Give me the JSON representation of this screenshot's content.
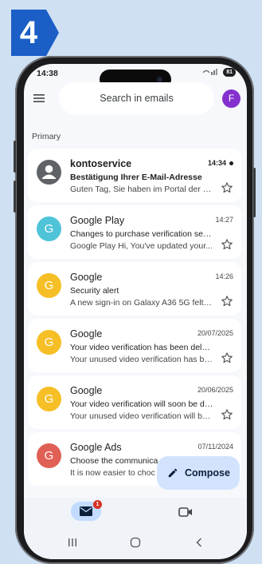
{
  "step": {
    "number": "4",
    "color": "#1a5ec6"
  },
  "status_bar": {
    "time": "14:38",
    "battery": "81"
  },
  "search": {
    "placeholder": "Search in emails"
  },
  "account": {
    "initial": "F",
    "color": "#8430ce"
  },
  "section": {
    "label": "Primary"
  },
  "emails": [
    {
      "sender": "kontoservice",
      "time": "14:34",
      "subject": "Bestätigung Ihrer E-Mail-Adresse",
      "snippet": "Guten Tag, Sie haben im Portal der B...",
      "avatar": "person-icon",
      "avatar_color": "#5f6368",
      "unread": true
    },
    {
      "sender": "Google Play",
      "time": "14:27",
      "subject": "Changes to purchase verification sett...",
      "snippet": "Google Play Hi, You've updated your...",
      "avatar": "G",
      "avatar_color": "#4fc3d8",
      "unread": false
    },
    {
      "sender": "Google",
      "time": "14:26",
      "subject": "Security alert",
      "snippet": "A new sign-in on Galaxy A36 5G felto...",
      "avatar": "G",
      "avatar_color": "#f6bf26",
      "unread": false
    },
    {
      "sender": "Google",
      "time": "20/07/2025",
      "subject": "Your video verification has been delet...",
      "snippet": "Your unused video verification has be...",
      "avatar": "G",
      "avatar_color": "#f6bf26",
      "unread": false
    },
    {
      "sender": "Google",
      "time": "20/06/2025",
      "subject": "Your video verification will soon be de...",
      "snippet": "Your unused video verification will be...",
      "avatar": "G",
      "avatar_color": "#f6bf26",
      "unread": false
    },
    {
      "sender": "Google Ads",
      "time": "07/11/2024",
      "subject": "Choose the communica",
      "snippet": "It is now easier to choc",
      "avatar": "G",
      "avatar_color": "#e06055",
      "unread": false
    }
  ],
  "compose": {
    "label": "Compose"
  },
  "bottom_nav": {
    "mail_badge": "1"
  },
  "colors": {
    "background": "#cfe0f3",
    "compose_bg": "#d3e3fd",
    "badge": "#d93025"
  }
}
